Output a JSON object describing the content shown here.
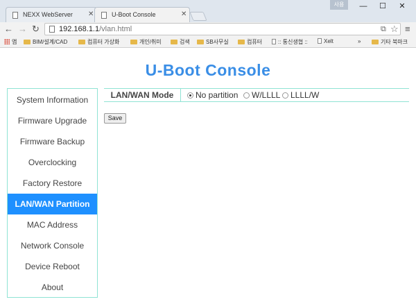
{
  "browser": {
    "tabs": [
      {
        "title": "NEXX WebServer",
        "active": false
      },
      {
        "title": "U-Boot Console",
        "active": true
      }
    ],
    "user_badge": "사용",
    "address": {
      "host": "192.168.1.1",
      "path": "/vlan.html"
    },
    "bookmarks": [
      {
        "label": "앱",
        "icon": "apps-icon"
      },
      {
        "label": "BIM/설계/CAD",
        "icon": "folder-icon"
      },
      {
        "label": "컴퓨터 가상화",
        "icon": "folder-icon"
      },
      {
        "label": "개인/취미",
        "icon": "folder-icon"
      },
      {
        "label": "검색",
        "icon": "folder-icon"
      },
      {
        "label": "SB사무실",
        "icon": "folder-icon"
      },
      {
        "label": "컴퓨터",
        "icon": "folder-icon"
      },
      {
        "label": ":: 통신생협 ::",
        "icon": "file-icon"
      },
      {
        "label": "Xelt",
        "icon": "file-icon"
      },
      {
        "label": "»",
        "icon": "chevron-icon"
      },
      {
        "label": "기타 북마크",
        "icon": "folder-icon"
      }
    ]
  },
  "page": {
    "title": "U-Boot Console",
    "sidebar": [
      {
        "label": "System Information",
        "active": false
      },
      {
        "label": "Firmware Upgrade",
        "active": false
      },
      {
        "label": "Firmware Backup",
        "active": false
      },
      {
        "label": "Overclocking",
        "active": false
      },
      {
        "label": "Factory Restore",
        "active": false
      },
      {
        "label": "LAN/WAN Partition",
        "active": true
      },
      {
        "label": "MAC Address",
        "active": false
      },
      {
        "label": "Network Console",
        "active": false
      },
      {
        "label": "Device Reboot",
        "active": false
      },
      {
        "label": "About",
        "active": false
      }
    ],
    "mode": {
      "label": "LAN/WAN Mode",
      "options": [
        {
          "label": "No partition",
          "checked": true
        },
        {
          "label": "W/LLLL",
          "checked": false
        },
        {
          "label": "LLLL/W",
          "checked": false
        }
      ]
    },
    "save_label": "Save"
  },
  "colors": {
    "accent": "#1e90ff",
    "title": "#3a8ee6",
    "border": "#8fe3d4"
  }
}
